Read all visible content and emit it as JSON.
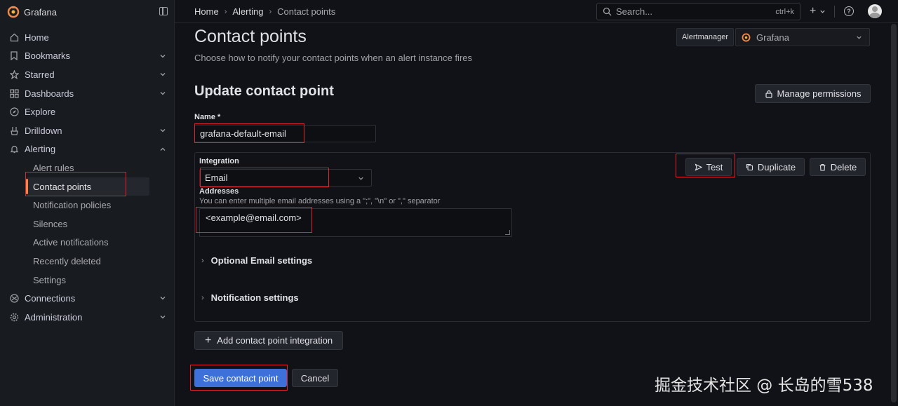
{
  "app": {
    "brand": "Grafana",
    "accent": "#f0884a",
    "primary": "#3d71d9"
  },
  "sidebar": {
    "items": [
      {
        "label": "Home",
        "icon": "home-icon"
      },
      {
        "label": "Bookmarks",
        "icon": "bookmark-icon",
        "expandable": true
      },
      {
        "label": "Starred",
        "icon": "star-icon",
        "expandable": true
      },
      {
        "label": "Dashboards",
        "icon": "apps-icon",
        "expandable": true
      },
      {
        "label": "Explore",
        "icon": "compass-icon"
      },
      {
        "label": "Drilldown",
        "icon": "drilldown-icon",
        "expandable": true
      },
      {
        "label": "Alerting",
        "icon": "bell-icon",
        "expanded": true
      }
    ],
    "alerting_children": [
      "Alert rules",
      "Contact points",
      "Notification policies",
      "Silences",
      "Active notifications",
      "Recently deleted",
      "Settings"
    ],
    "bottom_items": [
      {
        "label": "Connections",
        "icon": "connections-icon",
        "expandable": true
      },
      {
        "label": "Administration",
        "icon": "cog-icon",
        "expandable": true
      }
    ]
  },
  "topbar": {
    "breadcrumb": [
      "Home",
      "Alerting",
      "Contact points"
    ],
    "search_placeholder": "Search...",
    "search_shortcut": "ctrl+k"
  },
  "page": {
    "title": "Contact points",
    "subtitle": "Choose how to notify your contact points when an alert instance fires",
    "alertmanager_label": "Alertmanager",
    "alertmanager_value": "Grafana"
  },
  "form": {
    "heading": "Update contact point",
    "manage_permissions": "Manage permissions",
    "name_label": "Name *",
    "name_value": "grafana-default-email",
    "integration_label": "Integration",
    "integration_value": "Email",
    "addresses_label": "Addresses",
    "addresses_help": "You can enter multiple email addresses using a \";\", \"\\n\" or \",\" separator",
    "addresses_value": "<example@email.com>",
    "test_label": "Test",
    "duplicate_label": "Duplicate",
    "delete_label": "Delete",
    "optional_settings": "Optional Email settings",
    "notification_settings": "Notification settings",
    "add_integration": "Add contact point integration",
    "save": "Save contact point",
    "cancel": "Cancel"
  },
  "watermark": "掘金技术社区 @ 长岛的雪538"
}
